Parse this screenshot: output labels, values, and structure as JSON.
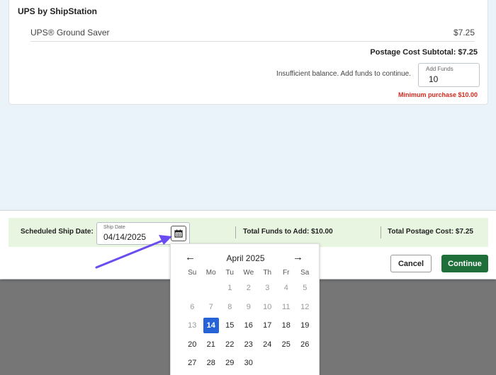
{
  "carrier": {
    "title": "UPS by ShipStation",
    "service_name": "UPS® Ground Saver",
    "service_price": "$7.25",
    "subtotal": "Postage Cost Subtotal: $7.25",
    "insufficient_text": "Insufficient balance. Add funds to continue.",
    "add_funds_label": "Add Funds",
    "add_funds_value": "10",
    "min_purchase": "Minimum purchase $10.00"
  },
  "footer": {
    "scheduled_label": "Scheduled Ship Date:",
    "ship_date_label": "Ship Date",
    "ship_date_value": "04/14/2025",
    "total_funds": "Total Funds to Add: $10.00",
    "total_postage": "Total Postage Cost: $7.25",
    "cancel_label": "Cancel",
    "continue_label": "Continue",
    "continue_color": "#1e6f3a"
  },
  "calendar": {
    "month_label": "April 2025",
    "prev_icon": "←",
    "next_icon": "→",
    "weekdays": [
      "Su",
      "Mo",
      "Tu",
      "We",
      "Th",
      "Fr",
      "Sa"
    ],
    "weeks": [
      [
        null,
        null,
        "1",
        "2",
        "3",
        "4",
        "5"
      ],
      [
        "6",
        "7",
        "8",
        "9",
        "10",
        "11",
        "12"
      ],
      [
        "13",
        "14",
        "15",
        "16",
        "17",
        "18",
        "19"
      ],
      [
        "20",
        "21",
        "22",
        "23",
        "24",
        "25",
        "26"
      ],
      [
        "27",
        "28",
        "29",
        "30",
        null,
        null,
        null
      ]
    ],
    "selected_day": "14",
    "last_disabled_day": 13,
    "selected_color": "#2563d6"
  },
  "annotation": {
    "arrow_color": "#6a4cf0"
  }
}
